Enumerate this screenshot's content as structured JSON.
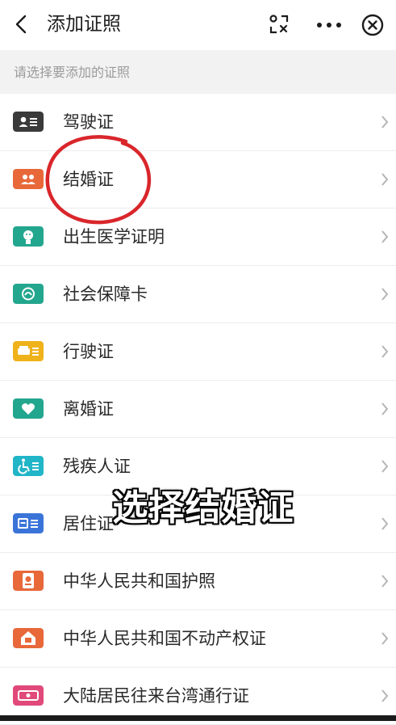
{
  "header": {
    "title": "添加证照"
  },
  "section_hint": "请选择要添加的证照",
  "items": [
    {
      "label": "驾驶证",
      "icon": "driver-license-icon",
      "color": "#3a3a3a"
    },
    {
      "label": "结婚证",
      "icon": "marriage-certificate-icon",
      "color": "#e8683a"
    },
    {
      "label": "出生医学证明",
      "icon": "birth-certificate-icon",
      "color": "#23a68e"
    },
    {
      "label": "社会保障卡",
      "icon": "social-security-card-icon",
      "color": "#23a68e"
    },
    {
      "label": "行驶证",
      "icon": "vehicle-license-icon",
      "color": "#f0b21a"
    },
    {
      "label": "离婚证",
      "icon": "divorce-certificate-icon",
      "color": "#23a68e"
    },
    {
      "label": "残疾人证",
      "icon": "disability-certificate-icon",
      "color": "#21b5c8"
    },
    {
      "label": "居住证",
      "icon": "residence-permit-icon",
      "color": "#3b74d9"
    },
    {
      "label": "中华人民共和国护照",
      "icon": "passport-icon",
      "color": "#e8683a"
    },
    {
      "label": "中华人民共和国不动产权证",
      "icon": "property-certificate-icon",
      "color": "#e8683a"
    },
    {
      "label": "大陆居民往来台湾通行证",
      "icon": "taiwan-travel-permit-icon",
      "color": "#e1497a"
    }
  ],
  "overlay_caption": "选择结婚证",
  "annotation_color": "#d9262b"
}
